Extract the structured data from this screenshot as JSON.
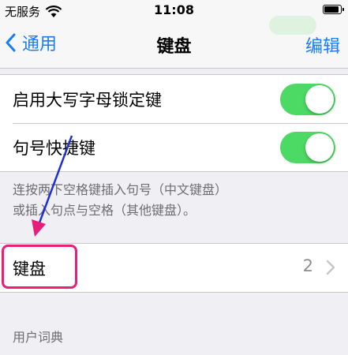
{
  "status_bar": {
    "carrier": "无服务",
    "time": "11:08"
  },
  "nav": {
    "back_label": "通用",
    "title": "键盘",
    "edit_label": "编辑"
  },
  "settings": {
    "caps_lock": {
      "label": "启用大写字母锁定键",
      "on": true
    },
    "period_shortcut": {
      "label": "句号快捷键",
      "on": true
    },
    "footnote_line1": "连按两下空格键插入句号（中文键盘）",
    "footnote_line2": "或插入句点与空格（其他键盘）。"
  },
  "keyboards": {
    "label": "键盘",
    "count": "2"
  },
  "user_dictionary": {
    "header": "用户词典"
  },
  "colors": {
    "accent": "#1a7cf6",
    "toggle_on": "#4cd964",
    "annotation": "#e81e7b",
    "arrow": "#1c2fd6"
  }
}
